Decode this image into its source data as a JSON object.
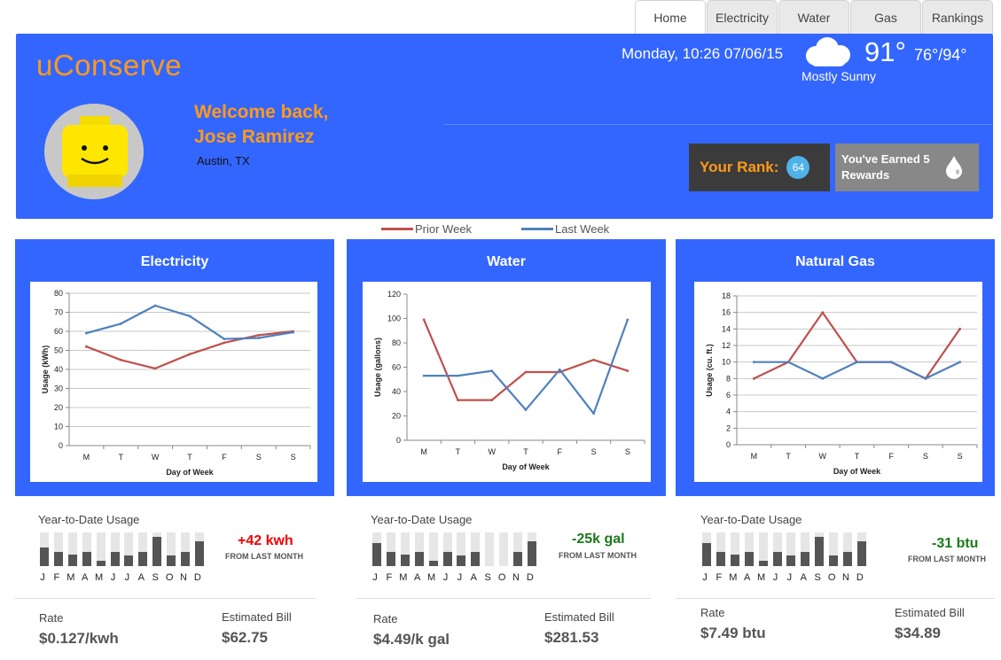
{
  "tabs": [
    {
      "label": "Home",
      "active": true
    },
    {
      "label": "Electricity",
      "active": false
    },
    {
      "label": "Water",
      "active": false
    },
    {
      "label": "Gas",
      "active": false
    },
    {
      "label": "Rankings",
      "active": false
    }
  ],
  "header": {
    "logo": "uConserve",
    "welcome_line1": "Welcome back,",
    "welcome_line2": "Jose Ramirez",
    "location": "Austin, TX",
    "datetime": "Monday, 10:26 07/06/15",
    "weather": {
      "icon": "cloud-icon",
      "temp": "91°",
      "hilo": "76°/94°",
      "conditions": "Mostly Sunny"
    },
    "rank_label": "Your Rank:",
    "rank_value": "64",
    "rewards_text": "You've Earned 5 Rewards",
    "rewards_icon": "water-drop-icon"
  },
  "colors": {
    "accent": "#3366ff",
    "brand": "#ff9a1a",
    "prior_week": "#c0504d",
    "last_week": "#4f81bd",
    "positive": "#ee0000",
    "negative": "#1a7a1a"
  },
  "legend": {
    "prior": "Prior Week",
    "last": "Last Week"
  },
  "panels": [
    {
      "title": "Electricity",
      "ytd_label": "Year-to-Date Usage",
      "monthly_levels": [
        0.55,
        0.42,
        0.34,
        0.42,
        0.16,
        0.42,
        0.32,
        0.42,
        0.88,
        0.32,
        0.42,
        0.74
      ],
      "delta": "+42 kwh",
      "delta_sub": "FROM LAST MONTH",
      "delta_color": "#ee0000",
      "rate_label": "Rate",
      "rate_value": "$0.127/kwh",
      "bill_label": "Estimated Bill",
      "bill_value": "$62.75"
    },
    {
      "title": "Water",
      "ytd_label": "Year-to-Date Usage",
      "monthly_levels": [
        0.68,
        0.42,
        0.34,
        0.42,
        0.16,
        0.42,
        0.32,
        0.42,
        0.0,
        0.0,
        0.42,
        0.74
      ],
      "delta": "-25k gal",
      "delta_sub": "FROM LAST MONTH",
      "delta_color": "#1a7a1a",
      "rate_label": "Rate",
      "rate_value": "$4.49/k gal",
      "bill_label": "Estimated Bill",
      "bill_value": "$281.53"
    },
    {
      "title": "Natural Gas",
      "ytd_label": "Year-to-Date Usage",
      "monthly_levels": [
        0.68,
        0.42,
        0.34,
        0.42,
        0.16,
        0.42,
        0.32,
        0.42,
        0.88,
        0.32,
        0.42,
        0.74
      ],
      "delta": "-31 btu",
      "delta_sub": "FROM LAST MONTH",
      "delta_color": "#1a7a1a",
      "rate_label": "Rate",
      "rate_value": "$7.49 btu",
      "bill_label": "Estimated Bill",
      "bill_value": "$34.89"
    }
  ],
  "months": [
    "J",
    "F",
    "M",
    "A",
    "M",
    "J",
    "J",
    "A",
    "S",
    "O",
    "N",
    "D"
  ],
  "chart_data": [
    {
      "type": "line",
      "title": "Electricity",
      "x": [
        "M",
        "T",
        "W",
        "T",
        "F",
        "S",
        "S"
      ],
      "series": [
        {
          "name": "Prior Week",
          "color": "#c0504d",
          "values": [
            52,
            45,
            40.5,
            48,
            54,
            58,
            60
          ]
        },
        {
          "name": "Last Week",
          "color": "#4f81bd",
          "values": [
            59,
            64,
            73.5,
            68,
            56,
            56.5,
            59.5
          ]
        }
      ],
      "xlabel": "Day of Week",
      "ylabel": "Usage (kWh)",
      "ylim": [
        0,
        80
      ],
      "yticks": [
        0,
        10,
        20,
        30,
        40,
        50,
        60,
        70,
        80
      ],
      "grid": true
    },
    {
      "type": "line",
      "title": "Water",
      "x": [
        "M",
        "T",
        "W",
        "T",
        "F",
        "S",
        "S"
      ],
      "series": [
        {
          "name": "Prior Week",
          "color": "#c0504d",
          "values": [
            99,
            33,
            33,
            56,
            56,
            66,
            57
          ]
        },
        {
          "name": "Last Week",
          "color": "#4f81bd",
          "values": [
            53,
            53,
            57,
            25,
            58,
            22,
            99
          ]
        }
      ],
      "xlabel": "Day of Week",
      "ylabel": "Usage (gallons)",
      "ylim": [
        0,
        120
      ],
      "yticks": [
        0,
        20,
        40,
        60,
        80,
        100,
        120
      ],
      "grid": false
    },
    {
      "type": "line",
      "title": "Natural Gas",
      "x": [
        "M",
        "T",
        "W",
        "T",
        "F",
        "S",
        "S"
      ],
      "series": [
        {
          "name": "Prior Week",
          "color": "#c0504d",
          "values": [
            8,
            10,
            16,
            10,
            10,
            8,
            14
          ]
        },
        {
          "name": "Last Week",
          "color": "#4f81bd",
          "values": [
            10,
            10,
            8,
            10,
            10,
            8,
            10
          ]
        }
      ],
      "xlabel": "Day of Week",
      "ylabel": "Usage (cu. ft.)",
      "ylim": [
        0,
        18
      ],
      "yticks": [
        0,
        2,
        4,
        6,
        8,
        10,
        12,
        14,
        16,
        18
      ],
      "grid": true
    }
  ]
}
